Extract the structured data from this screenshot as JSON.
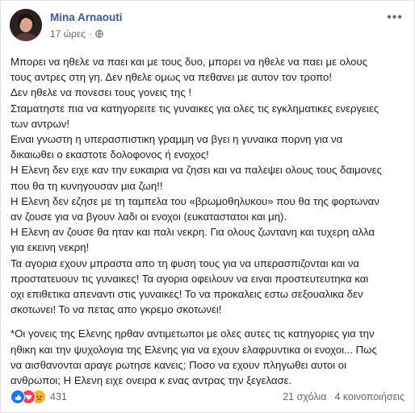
{
  "post": {
    "author": "Mina Arnaouti",
    "time": "17 ώρες",
    "separator": "·",
    "lines": [
      "Μπορει να ηθελε να παει και με τους δυο, μπορει να ηθελε να παει με ολους",
      "τους αντρες στη γη. Δεν ηθελε ομως να πεθανει με αυτον τον τροπο!",
      "Δεν ηθελε να πονεσει τους γονεις της !",
      "Σταματηστε πια να κατηγορειτε τις γυναικες για ολες τις εγκληματικες ενεργειες",
      "των αντρων!",
      "Ειναι γνωστη η υπερασπιστικη γραμμη να βγει η γυναικα πορνη για να",
      "δικαιωθει ο εκαστοτε δολοφονος ή ενοχος!",
      "Η Ελενη δεν ειχε καν την ευκαιρια να ζησει και να παλεψει ολους τους δαιμονες",
      "που θα τη κυνηγουσαν μια ζωη!!",
      "Η Ελενη δεν εζησε με τη ταμπελα του «βρωμοθηλυκου» που θα της φορτωναν",
      "αν ζουσε για να βγουν λαδι οι ενοχοι (ευκαταστατοι και μη).",
      "Η Ελενη αν ζουσε θα ηταν και παλι νεκρη. Για ολους ζωντανη και τυχερη αλλα",
      "για εκεινη νεκρη!",
      "Τα αγορια εχουν μπραστα απο τη φυση τους για να υπερασπιζονται και να",
      "προστατευουν τις γυναικες! Τα αγορια οφειλουν να ειναι προστευτευτηκα και",
      "οχι επιθετικα απεναντι στις γυναικες! Το να προκαλεις εστω σεξουαλικα δεν",
      "σκοτωνει! Το να πετας απο γκρεμο σκοτωνει!",
      "*Οι γονεις της Ελενης ηρθαν αντιμετωποι με ολες αυτες τις κατηγοριες για την",
      "ηθικη και την ψυχολογια της Ελενης για να εχουν ελαφρυντικα οι ενοχοι... Πως",
      "να αισθανονται αραγε ρωτησε κανεις; Ποσο να εχουν πληγωθει αυτοι οι",
      "ανθρωποι; Η Ελενη ειχε ονειρα κ ενας αντρας την ξεγελασε."
    ]
  },
  "footer": {
    "reaction_count": "431",
    "comments": "21 σχόλια",
    "shares": "4 κοινοποιήσεις"
  },
  "colors": {
    "author": "#385898",
    "like": "#1877f2",
    "love": "#f33e58",
    "sad": "#f7b125"
  }
}
